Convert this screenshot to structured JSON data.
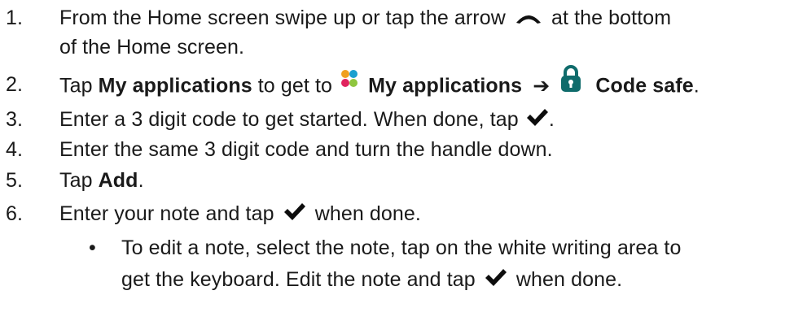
{
  "steps": [
    {
      "number": "1.",
      "line1": "From the Home screen swipe up or tap the arrow",
      "line1_tail": "at the bottom",
      "line2": "of the Home screen.",
      "icon": "chevron-up-icon"
    },
    {
      "number": "2.",
      "part1": "Tap ",
      "bold1": "My applications",
      "part2": " to get to ",
      "bold2": "My applications",
      "arrow": "➔",
      "bold3": "Code safe",
      "end": ".",
      "icons": [
        "apps-icon",
        "padlock-icon"
      ],
      "icon_colors": {
        "apps": [
          "#f0a020",
          "#e0245e",
          "#1aa0d0",
          "#8fc63f"
        ],
        "padlock": "#0f6b6b"
      }
    },
    {
      "number": "3.",
      "text": "Enter a 3 digit code to get started. When done, tap",
      "end": ".",
      "icon": "checkmark-icon"
    },
    {
      "number": "4.",
      "text": "Enter the same 3 digit code and turn the handle down."
    },
    {
      "number": "5.",
      "part1": "Tap ",
      "bold1": "Add",
      "end": "."
    },
    {
      "number": "6.",
      "part1": "Enter your note and tap",
      "part2": "when done.",
      "icon": "checkmark-icon"
    }
  ],
  "sub_bullet": {
    "bullet": "•",
    "line1": "To edit a note, select the note, tap on the white writing area to",
    "line2_part1": "get the keyboard. Edit the note and tap",
    "line2_part2": "when done.",
    "icon": "checkmark-icon"
  }
}
